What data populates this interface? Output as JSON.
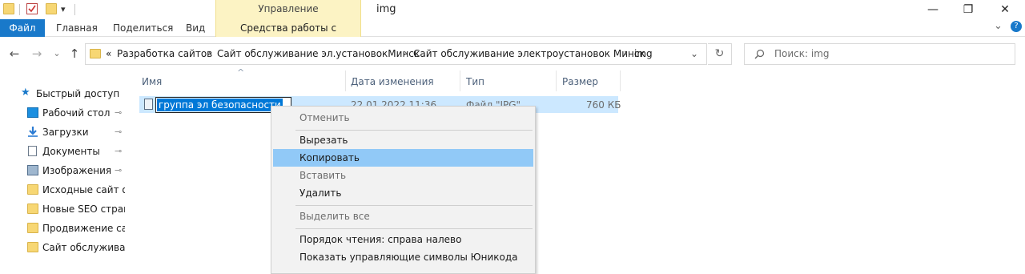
{
  "titlebar": {
    "context_group": "Управление",
    "window_title": "img",
    "minimize": "—",
    "maximize": "❐",
    "close": "✕"
  },
  "ribbon": {
    "file_tab": "Файл",
    "tabs": [
      "Главная",
      "Поделиться",
      "Вид"
    ],
    "picture_tools_tab": "Средства работы с рисунками",
    "expand": "⌄",
    "help": "?"
  },
  "address": {
    "overflow": "«",
    "crumbs": [
      "Разработка сайтов",
      "Сайт обслуживание эл.установокМинск",
      "Сайт обслуживание электроустановок Минск",
      "img"
    ],
    "separator": "›",
    "dropdown": "⌄",
    "refresh": "↻"
  },
  "search": {
    "placeholder": "Поиск: img"
  },
  "nav_buttons": {
    "back": "←",
    "forward": "→",
    "recent": "⌄",
    "up": "↑"
  },
  "navpane": {
    "quick_access": "Быстрый доступ",
    "items": [
      {
        "label": "Рабочий стол",
        "icon": "desktop-icon",
        "pinned": true
      },
      {
        "label": "Загрузки",
        "icon": "downloads-icon",
        "pinned": true
      },
      {
        "label": "Документы",
        "icon": "documents-icon",
        "pinned": true
      },
      {
        "label": "Изображения",
        "icon": "pictures-icon",
        "pinned": true
      },
      {
        "label": "Исходные сайт обс",
        "icon": "folder-icon",
        "pinned": false
      },
      {
        "label": "Новые SEO страни",
        "icon": "folder-icon",
        "pinned": false
      },
      {
        "label": "Продвижение сайт",
        "icon": "folder-icon",
        "pinned": false
      },
      {
        "label": "Сайт обслуживани",
        "icon": "folder-icon",
        "pinned": false
      }
    ],
    "pin_glyph": "⊸"
  },
  "columns": {
    "name": "Имя",
    "date": "Дата изменения",
    "type": "Тип",
    "size": "Размер",
    "sort_indicator": "^"
  },
  "file": {
    "rename_text": "группа эл безопасности",
    "date": "22.01.2022 11:36",
    "type": "Файл \"JPG\"",
    "size": "760 КБ"
  },
  "context_menu": {
    "undo": "Отменить",
    "cut": "Вырезать",
    "copy": "Копировать",
    "paste": "Вставить",
    "delete": "Удалить",
    "select_all": "Выделить все",
    "rtl": "Порядок чтения: справа налево",
    "unicode": "Показать управляющие символы Юникода"
  },
  "colors": {
    "accent": "#1979ca",
    "selection": "#0078d7",
    "row_highlight": "#cce8ff",
    "menu_hover": "#91c9f7",
    "context_tab": "#fcf3c4"
  }
}
